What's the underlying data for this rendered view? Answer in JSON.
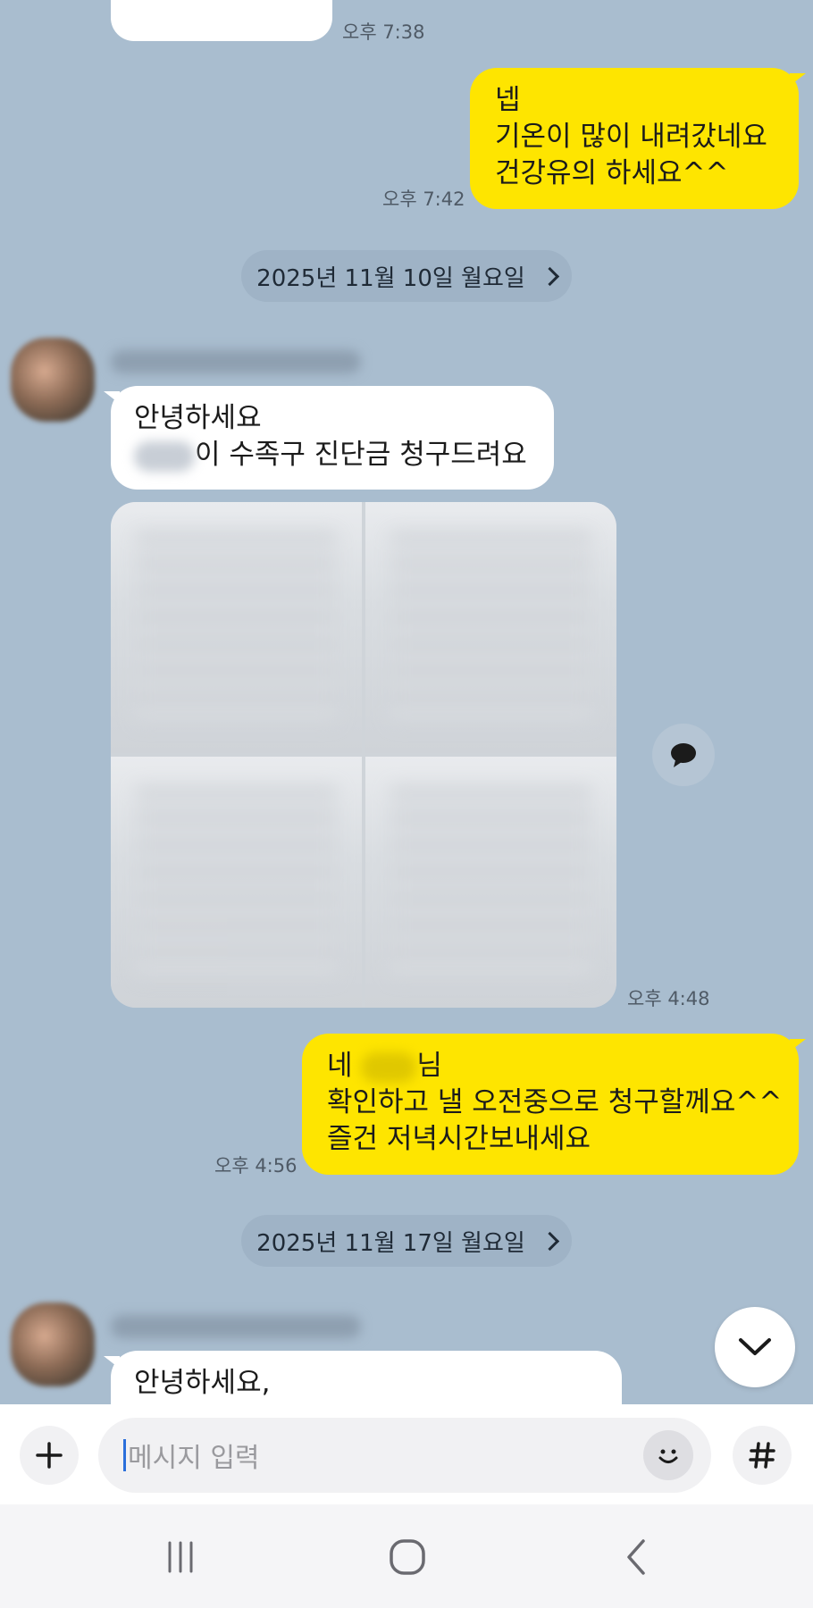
{
  "messages": {
    "prev_time": "오후 7:38",
    "me1": {
      "lines": [
        "넵",
        "기온이 많이 내려갔네요",
        "건강유의 하세요^^"
      ],
      "time": "오후 7:42"
    },
    "date1": "2025년 11월 10일 월요일",
    "other1": {
      "line1": "안녕하세요",
      "line2_suffix": "이 수족구 진단금 청구드려요"
    },
    "photo_time": "오후 4:48",
    "me2": {
      "line1_prefix": "네",
      "line1_suffix": "님",
      "line2": "확인하고 낼 오전중으로 청구할께요^^",
      "line3": "즐건 저녁시간보내세요",
      "time": "오후 4:56"
    },
    "date2": "2025년 11월 17일 월요일",
    "other2": {
      "line1": "안녕하세요,"
    }
  },
  "input": {
    "placeholder": "메시지 입력"
  },
  "icons": {
    "plus": "plus-icon",
    "emoji": "emoji-icon",
    "hashtag": "hashtag-icon",
    "share": "speech-bubble-icon",
    "scroll": "chevron-down-icon",
    "nav_recent": "recent-apps-icon",
    "nav_home": "home-icon",
    "nav_back": "back-icon"
  },
  "colors": {
    "chat_bg": "#a9bdcf",
    "my_bubble": "#fee500",
    "other_bubble": "#ffffff"
  }
}
